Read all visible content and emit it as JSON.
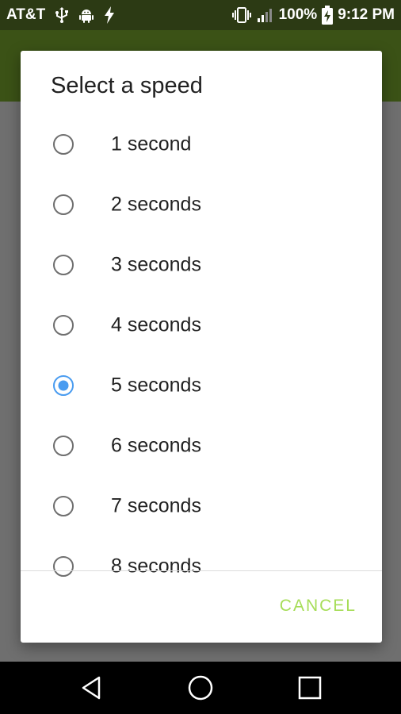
{
  "status_bar": {
    "carrier": "AT&T",
    "battery_percent": "100%",
    "time": "9:12 PM",
    "icons_left": [
      "usb-icon",
      "android-icon",
      "charging-bolt-icon"
    ],
    "icons_right": [
      "vibrate-icon",
      "signal-icon",
      "battery-charging-icon"
    ]
  },
  "dialog": {
    "title": "Select a speed",
    "options": [
      {
        "label": "1 second",
        "selected": false
      },
      {
        "label": "2 seconds",
        "selected": false
      },
      {
        "label": "3 seconds",
        "selected": false
      },
      {
        "label": "4 seconds",
        "selected": false
      },
      {
        "label": "5 seconds",
        "selected": true
      },
      {
        "label": "6 seconds",
        "selected": false
      },
      {
        "label": "7 seconds",
        "selected": false
      },
      {
        "label": "8 seconds",
        "selected": false
      }
    ],
    "cancel_label": "CANCEL"
  },
  "nav_bar": {
    "buttons": [
      "back-icon",
      "home-icon",
      "recents-icon"
    ]
  },
  "colors": {
    "status_bar": "#2c3a14",
    "toolbar": "#3b5216",
    "accent_radio": "#4a9cf0",
    "cancel_text": "#a6dd57",
    "scrim": "#6f6f6f"
  }
}
